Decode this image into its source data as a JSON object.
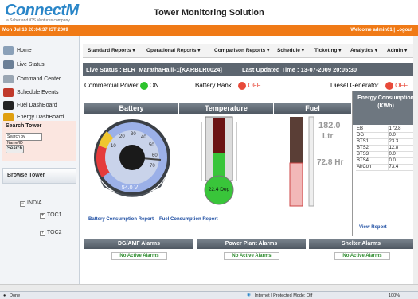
{
  "header": {
    "logo": "ConnectM",
    "logo_sub": "a Saber and iOS Ventures company",
    "title": "Tower Monitoring Solution",
    "datetime": "Mon Jul 13 20:04:37 IST 2009",
    "welcome": "Welcome admin01 | Logout"
  },
  "sidebar": {
    "items": [
      {
        "label": "Home",
        "icon": "home-icon",
        "color": "#8aa0b8"
      },
      {
        "label": "Live Status",
        "icon": "live-status-icon",
        "color": "#6b7f96"
      },
      {
        "label": "Command Center",
        "icon": "command-center-icon",
        "color": "#9aa6b3"
      },
      {
        "label": "Schedule Events",
        "icon": "schedule-icon",
        "color": "#c0392b"
      },
      {
        "label": "Fuel DashBoard",
        "icon": "fuel-icon",
        "color": "#222222"
      },
      {
        "label": "Energy DashBoard",
        "icon": "energy-icon",
        "color": "#e0a010"
      }
    ],
    "search": {
      "label": "Search Tower",
      "input_value": "Search by Name/ID",
      "button": "Search"
    },
    "browse_label": "Browse Tower",
    "tree": {
      "root": "INDIA",
      "children": [
        "TOC1",
        "TOC2"
      ]
    }
  },
  "menu": [
    "Standard Reports ▾",
    "Operational Reports ▾",
    "Comparison Reports ▾",
    "Schedule ▾",
    "Ticketing ▾",
    "Analytics ▾",
    "Admin ▾"
  ],
  "live": {
    "status": "Live Status : BLR_MarathaHalli-1[KARBLR0024]",
    "updated": "Last Updated Time : 13-07-2009 20:05:30"
  },
  "power": {
    "commercial_label": "Commercial Power",
    "commercial_state": "ON",
    "commercial_color": "#2ec42e",
    "battery_label": "Battery Bank",
    "battery_state": "OFF",
    "battery_color": "#e84a3a",
    "diesel_label": "Diesel Generator",
    "diesel_state": "OFF",
    "diesel_color": "#e84a3a"
  },
  "panels": {
    "battery": {
      "title": "Battery",
      "value": "54.0 V",
      "gauge_ticks": [
        "10",
        "20",
        "30",
        "40",
        "50",
        "60",
        "70"
      ]
    },
    "temperature": {
      "title": "Temperature",
      "value": "22.4 Deg",
      "fill_fraction": 0.45
    },
    "fuel": {
      "title": "Fuel",
      "ltr_value": "182.0",
      "ltr_unit": "Ltr",
      "hr_value": "72.8 Hr",
      "fill_fraction": 0.5
    },
    "links": [
      "Battery Consumption Report",
      "Fuel Consumption Report"
    ]
  },
  "energy": {
    "title": "Energy Consumption (KWh)",
    "rows": [
      {
        "name": "EB",
        "value": "172.8"
      },
      {
        "name": "DG",
        "value": "0.0"
      },
      {
        "name": "BTS1",
        "value": "23.3"
      },
      {
        "name": "BTS2",
        "value": "12.8"
      },
      {
        "name": "BTS3",
        "value": "0.0"
      },
      {
        "name": "BTS4",
        "value": "0.0"
      },
      {
        "name": "AirCon",
        "value": "73.4"
      }
    ],
    "view_report": "View Report"
  },
  "alarms": [
    {
      "title": "DG/AMF Alarms",
      "status": "No Active Alarms"
    },
    {
      "title": "Power Plant Alarms",
      "status": "No Active Alarms"
    },
    {
      "title": "Shelter Alarms",
      "status": "No Active Alarms"
    }
  ],
  "statusbar": {
    "done": "Done",
    "zone": "Internet | Protected Mode: Off",
    "zoom": "100%"
  }
}
